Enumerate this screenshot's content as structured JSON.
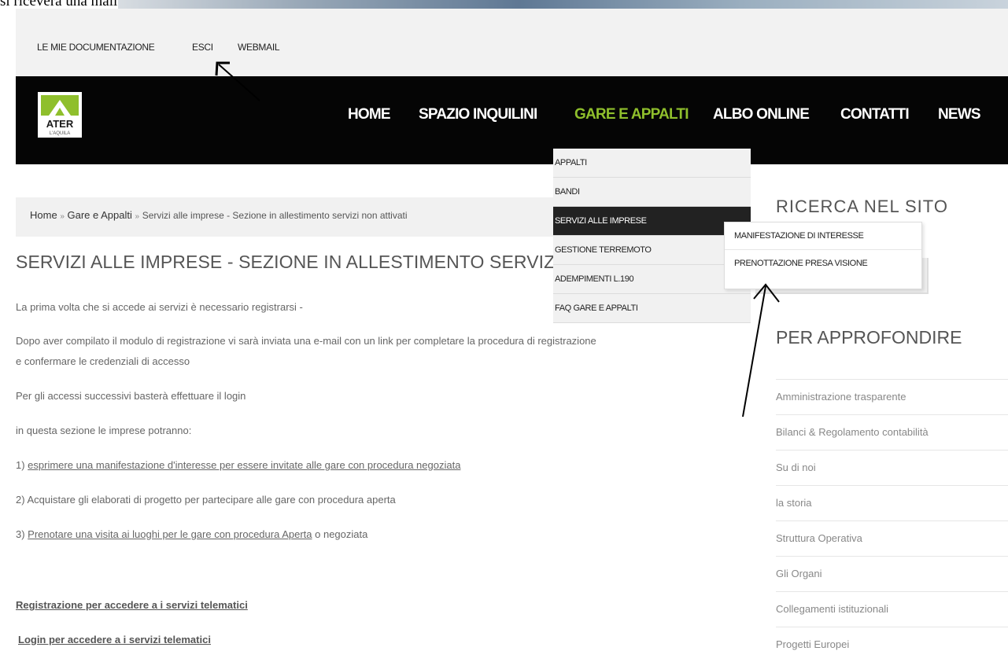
{
  "cutoff_text": "si riceverà una mail di conferma",
  "top_links": [
    "LE MIE DOCUMENTAZIONE",
    "ESCI",
    "WEBMAIL"
  ],
  "logo": {
    "text": "ATER",
    "subtext": "L'AQUILA",
    "accent": "#8fbf2c"
  },
  "nav": {
    "items": [
      "HOME",
      "SPAZIO INQUILINI",
      "GARE E APPALTI",
      "ALBO ONLINE",
      "CONTATTI",
      "NEWS"
    ],
    "active": "GARE E APPALTI",
    "active_color": "#8fbf2c"
  },
  "dropdown": {
    "items": [
      "APPALTI",
      "BANDI",
      "SERVIZI ALLE IMPRESE",
      "GESTIONE TERREMOTO",
      "ADEMPIMENTI L.190",
      "FAQ GARE E APPALTI"
    ],
    "active": "SERVIZI ALLE IMPRESE",
    "submenu": [
      "MANIFESTAZIONE DI INTERESSE",
      "PRENOTTAZIONE PRESA VISIONE"
    ]
  },
  "breadcrumb": {
    "home": "Home",
    "sep": "»",
    "section": "Gare e Appalti",
    "current": "Servizi alle imprese - Sezione in allestimento servizi non attivati"
  },
  "page_title": "SERVIZI ALLE IMPRESE - SEZIONE IN ALLESTIMENTO SERVIZI NON ATTIVATI",
  "content": {
    "p1": "La prima volta che si accede ai servizi è necessario registrarsi -",
    "p2a": "Dopo aver compilato il modulo di registrazione vi sarà inviata una e-mail con un link per completare la procedura di registrazione",
    "p2b": "e confermare le credenziali di accesso",
    "p3": "Per gli accessi successivi basterà effettuare il login",
    "p4": "in questa sezione le imprese potranno:",
    "item1_prefix": "1) ",
    "item1_link": "esprimere una manifestazione d'interesse per essere invitate alle gare con procedura negoziata",
    "item2": "2) Acquistare gli elaborati di progetto per partecipare alle gare con procedura aperta",
    "item3_prefix": "3) ",
    "item3_link": "Prenotare una visita ai luoghi per le gare con procedura Aperta",
    "item3_suffix": " o negoziata",
    "link_register": "Registrazione per accedere a i servizi telematici",
    "link_login": "Login per accedere a i servizi telematici"
  },
  "sidebar": {
    "search_title": "RICERCA NEL SITO",
    "more_title": "PER APPROFONDIRE",
    "items": [
      "Amministrazione trasparente",
      "Bilanci & Regolamento contabilità",
      "Su di noi",
      "la storia",
      "Struttura Operativa",
      "Gli Organi",
      "Collegamenti istituzionali",
      "Progetti Europei"
    ]
  }
}
